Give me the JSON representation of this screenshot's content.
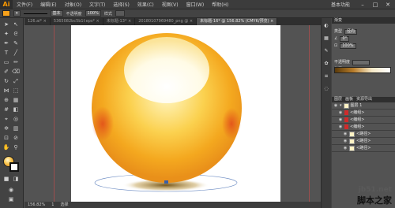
{
  "app": {
    "logo": "Ai"
  },
  "menu": {
    "items": [
      "文件(F)",
      "编辑(E)",
      "对象(O)",
      "文字(T)",
      "选择(S)",
      "效果(C)",
      "视图(V)",
      "窗口(W)",
      "帮助(H)"
    ],
    "workspace": "基本功能",
    "minimize": "–",
    "maximize": "□",
    "close": "✕"
  },
  "control": {
    "fill_color": "#f7a21b",
    "stroke_style": "基本",
    "opacity_label": "不透明度",
    "opacity_value": "100%",
    "style_label": "样式"
  },
  "tabs": [
    {
      "label": "126.ai* ×",
      "active": false
    },
    {
      "label": "5365082bc5b1f.eps* ×",
      "active": false
    },
    {
      "label": "未标题-13* ×",
      "active": false
    },
    {
      "label": "20180107969480_png @ ×",
      "active": false
    },
    {
      "label": "未标题-16* @ 156.82% (CMYK/预览) ×",
      "active": true
    }
  ],
  "gradient_panel": {
    "tab": "渐变",
    "type_label": "类型",
    "type_value": "径向",
    "angle_value": "0°",
    "ratio_value": "100%",
    "opacity_label": "不透明度",
    "location_label": "位置"
  },
  "layers_panel": {
    "tabs": [
      "图层",
      "画板",
      "资源导出"
    ],
    "layers": [
      {
        "name": "图层 1",
        "indent": 0
      },
      {
        "name": "<编组>",
        "indent": 1
      },
      {
        "name": "<编组>",
        "indent": 1
      },
      {
        "name": "<编组>",
        "indent": 1
      },
      {
        "name": "<路径>",
        "indent": 2
      },
      {
        "name": "<路径>",
        "indent": 2
      },
      {
        "name": "<路径>",
        "indent": 2
      }
    ]
  },
  "status": {
    "zoom": "156.82%",
    "page": "1",
    "mode": "选择"
  },
  "watermark": {
    "url": "jb51.net",
    "site": "脚本之家"
  },
  "icons": [
    "selection-tool-icon",
    "direct-selection-tool-icon",
    "pen-tool-icon",
    "type-tool-icon",
    "line-tool-icon",
    "rectangle-tool-icon",
    "brush-tool-icon",
    "rotate-tool-icon",
    "scale-tool-icon",
    "gradient-tool-icon",
    "eyedropper-tool-icon",
    "hand-tool-icon",
    "zoom-tool-icon"
  ]
}
